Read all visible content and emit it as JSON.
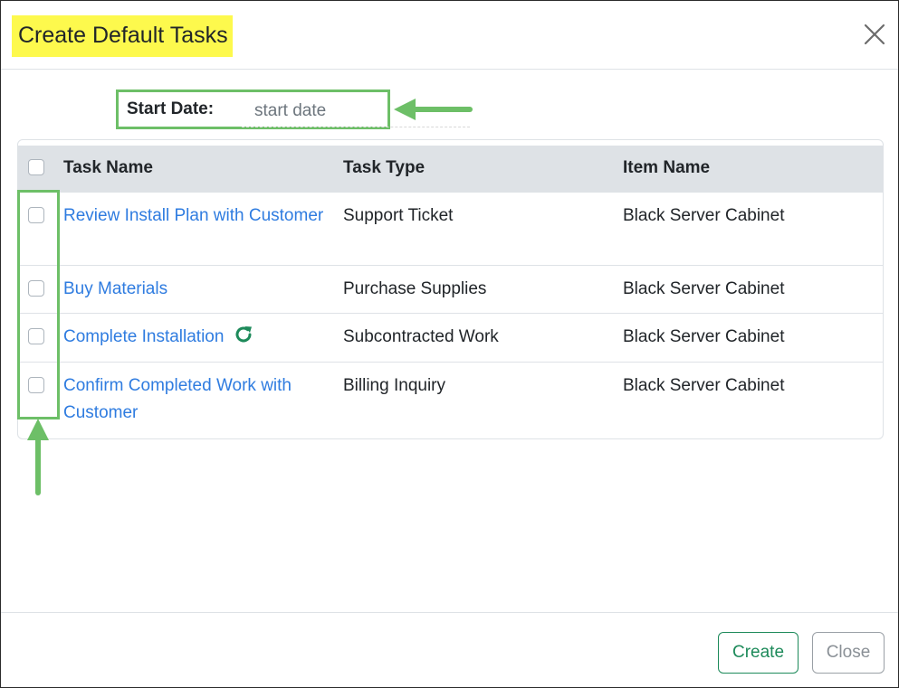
{
  "modal": {
    "title": "Create Default Tasks",
    "close_icon": "close-icon"
  },
  "start_date": {
    "label": "Start Date:",
    "placeholder": "start date"
  },
  "table": {
    "headers": [
      "Task Name",
      "Task Type",
      "Item Name"
    ],
    "rows": [
      {
        "task_name": "Review Install Plan with Customer",
        "task_type": "Support Ticket",
        "item_name": "Black Server Cabinet",
        "checked": false
      },
      {
        "task_name": "Buy Materials",
        "task_type": "Purchase Supplies",
        "item_name": "Black Server Cabinet",
        "checked": false
      },
      {
        "task_name": "Complete Installation",
        "task_type": "Subcontracted Work",
        "item_name": "Black Server Cabinet",
        "checked": false,
        "icon": "refresh-icon"
      },
      {
        "task_name": "Confirm Completed Work with Customer",
        "task_type": "Billing Inquiry",
        "item_name": "Black Server Cabinet",
        "checked": false
      }
    ]
  },
  "footer": {
    "create_label": "Create",
    "close_label": "Close"
  },
  "colors": {
    "title_highlight": "#fdf94d",
    "annotation_green": "#6dbf67",
    "link_blue": "#2f7ce0",
    "create_green": "#1d8a5a",
    "refresh_green": "#1d8a5a"
  }
}
